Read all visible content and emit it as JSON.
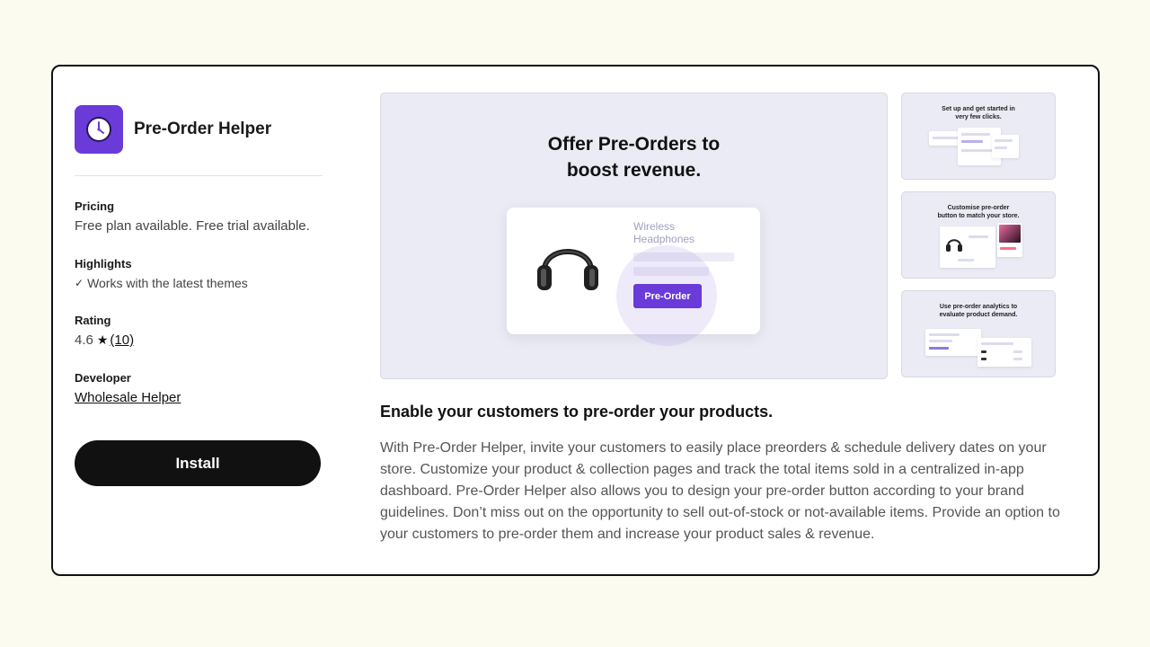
{
  "app": {
    "name": "Pre-Order Helper",
    "icon": "clock-icon",
    "brand_color": "#6a3bd8"
  },
  "details": {
    "pricing_label": "Pricing",
    "pricing_value": "Free plan available. Free trial available.",
    "highlights_label": "Highlights",
    "highlight_item": "Works with the latest themes",
    "rating_label": "Rating",
    "rating_value": "4.6",
    "rating_count": "(10)",
    "developer_label": "Developer",
    "developer_name": "Wholesale Helper"
  },
  "install_label": "Install",
  "gallery": {
    "main": {
      "headline_line1": "Offer Pre-Orders to",
      "headline_line2": "boost revenue.",
      "product_name_line1": "Wireless",
      "product_name_line2": "Headphones",
      "button_label": "Pre-Order"
    },
    "thumbs": [
      {
        "line1": "Set up and get started in",
        "line2": "very few clicks."
      },
      {
        "line1": "Customise pre-order",
        "line2": "button to match your store."
      },
      {
        "line1": "Use pre-order analytics to",
        "line2": "evaluate product demand."
      }
    ]
  },
  "description": {
    "heading": "Enable your customers to pre-order your products.",
    "body": "With Pre-Order Helper, invite your customers to easily place preorders & schedule delivery dates on your store. Customize your product & collection pages and track the total items sold in a centralized in-app dashboard. Pre-Order Helper also allows you to design your pre-order button according to your brand guidelines. Don’t miss out on the opportunity to sell out-of-stock or not-available items. Provide an option to your customers to pre-order them and increase your product sales & revenue."
  }
}
